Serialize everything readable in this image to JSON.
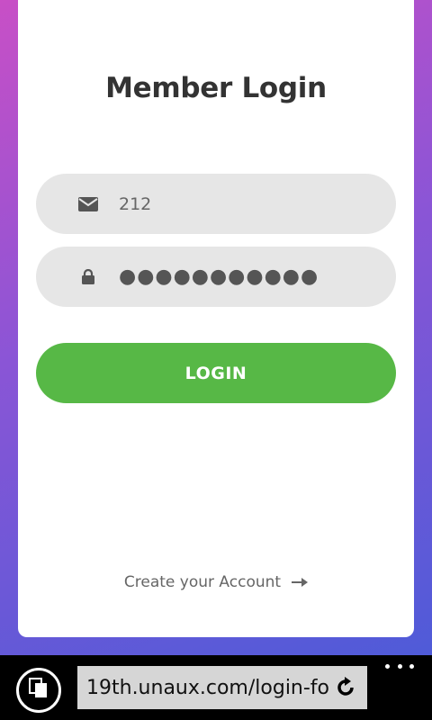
{
  "page": {
    "title": "Member Login"
  },
  "form": {
    "username_value": "212",
    "password_value": "●●●●●●●●●●●",
    "login_label": "LOGIN"
  },
  "footer": {
    "create_account_label": "Create your Account"
  },
  "browser": {
    "url": "19th.unaux.com/login-fo"
  },
  "icons": {
    "username": "envelope-icon",
    "password": "lock-icon",
    "create_account": "arrow-right-icon",
    "tabs": "tabs-icon",
    "reload": "reload-icon",
    "more": "more-dots-icon"
  },
  "colors": {
    "gradient_top": "#c84fc6",
    "gradient_bottom": "#4f5bd8",
    "login_button": "#57b846",
    "field_bg": "#e6e6e6"
  }
}
